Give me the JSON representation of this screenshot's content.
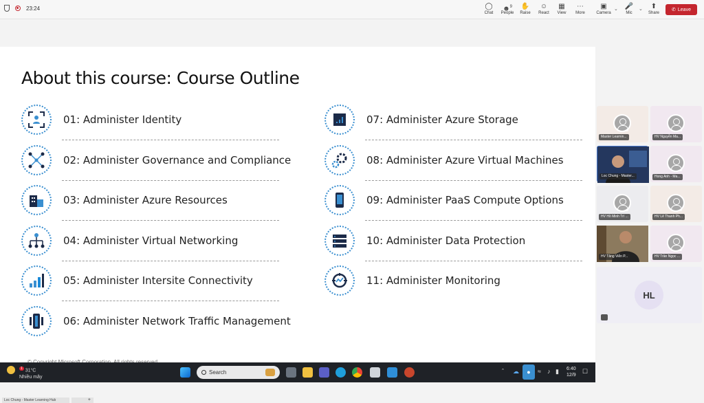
{
  "meeting": {
    "timer": "23:24",
    "controls": {
      "chat": "Chat",
      "people": "People",
      "people_count": "9",
      "raise": "Raise",
      "react": "React",
      "view": "View",
      "more": "More",
      "camera": "Camera",
      "mic": "Mic",
      "share": "Share",
      "leave": "Leave"
    }
  },
  "slide": {
    "title": "About this course: Course Outline",
    "left_items": [
      "01: Administer Identity",
      "02: Administer Governance and Compliance",
      "03: Administer Azure Resources",
      "04: Administer Virtual Networking",
      "05: Administer Intersite Connectivity",
      "06: Administer Network Traffic Management"
    ],
    "right_items": [
      "07: Administer Azure Storage",
      "08: Administer Azure Virtual Machines",
      "09: Administer PaaS Compute Options",
      "10: Administer Data Protection",
      "11:  Administer Monitoring"
    ],
    "copyright": "© Copyright Microsoft Corporation. All rights reserved."
  },
  "participants": [
    "Master Learnin...",
    "HV Nguyễn Ma...",
    "Loc Chung - Master...",
    "Hong Anh - Ma...",
    "HV Hồ Minh Trí ...",
    "HV Lê Thanh Ph...",
    "HV Tăng Viễn P...",
    "HV Trần Ngọc ..."
  ],
  "hl_initials": "HL",
  "taskbar": {
    "temperature": "31°C",
    "weather_alert": "1",
    "weather": "Nhiều mây",
    "search_placeholder": "Search",
    "time": "6:40",
    "date": "12/9"
  },
  "bottom_tabs": {
    "active": "Loc Chung - Master Learning Hub",
    "new_tab": "+"
  },
  "colors": {
    "accent": "#3a8fd0",
    "leave": "#c4262e",
    "taskbar": "#1f2227",
    "icon_dark": "#1b2a48"
  }
}
